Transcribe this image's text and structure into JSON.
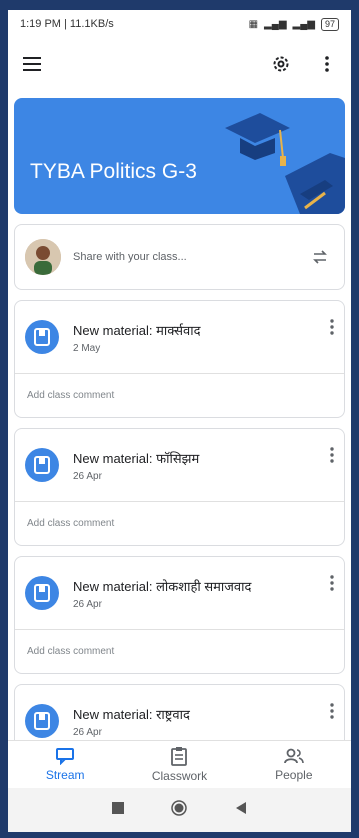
{
  "status": {
    "time_speed": "1:19 PM | 11.1KB/s",
    "battery": "97"
  },
  "class": {
    "name": "TYBA Politics G-3",
    "accent_color": "#3d86e4"
  },
  "share": {
    "placeholder": "Share with your class..."
  },
  "posts": [
    {
      "title": "New material: मार्क्सवाद",
      "date": "2 May",
      "comment_placeholder": "Add class comment"
    },
    {
      "title": "New material: फॉसिझम",
      "date": "26 Apr",
      "comment_placeholder": "Add class comment"
    },
    {
      "title": "New material: लोकशाही समाजवाद",
      "date": "26 Apr",
      "comment_placeholder": "Add class comment"
    },
    {
      "title": "New material: राष्ट्रवाद",
      "date": "26 Apr"
    }
  ],
  "bottom_nav": {
    "stream": "Stream",
    "classwork": "Classwork",
    "people": "People"
  },
  "icons": [
    "menu-icon",
    "settings-icon",
    "more-vert-icon",
    "repost-icon",
    "material-icon",
    "stream-icon",
    "classwork-icon",
    "people-icon"
  ]
}
